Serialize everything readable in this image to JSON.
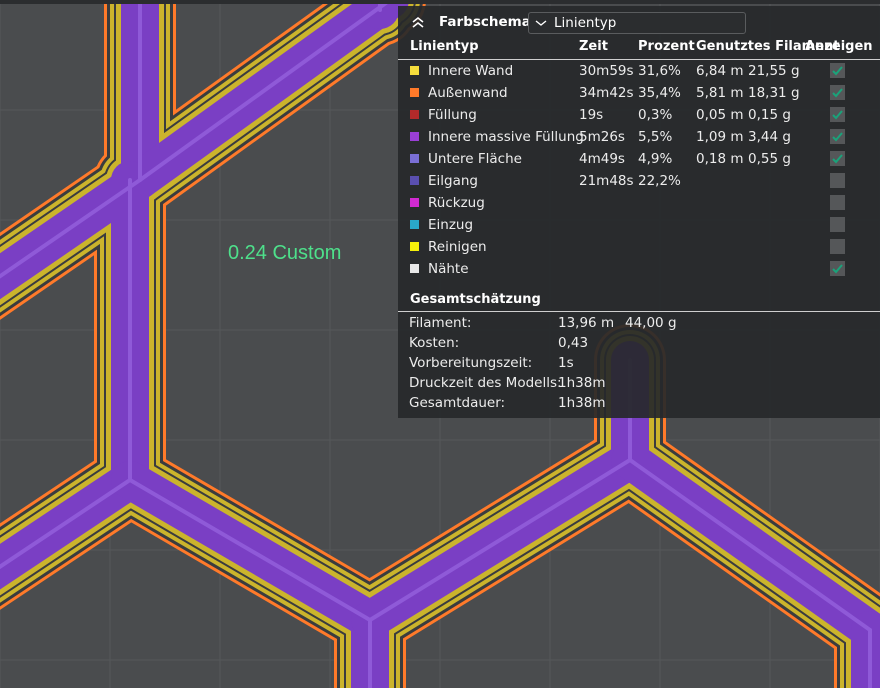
{
  "plate_label": "0.24 Custom",
  "panel": {
    "title": "Farbschema",
    "scheme_select": "Linientyp",
    "columns": [
      "Linientyp",
      "Zeit",
      "Prozent",
      "Genutztes Filament",
      "Anzeigen"
    ],
    "rows": [
      {
        "name": "Innere Wand",
        "time": "30m59s",
        "percent": "31,6%",
        "length": "6,84 m",
        "weight": "21,55 g",
        "color": "#f5dd3c",
        "shown": true
      },
      {
        "name": "Außenwand",
        "time": "34m42s",
        "percent": "35,4%",
        "length": "5,81 m",
        "weight": "18,31 g",
        "color": "#ff7a2a",
        "shown": true
      },
      {
        "name": "Füllung",
        "time": "19s",
        "percent": "0,3%",
        "length": "0,05 m",
        "weight": "0,15 g",
        "color": "#b22a2a",
        "shown": true
      },
      {
        "name": "Innere massive Füllung",
        "time": "5m26s",
        "percent": "5,5%",
        "length": "1,09 m",
        "weight": "3,44 g",
        "color": "#9a3fd6",
        "shown": true
      },
      {
        "name": "Untere Fläche",
        "time": "4m49s",
        "percent": "4,9%",
        "length": "0,18 m",
        "weight": "0,55 g",
        "color": "#7a6fd6",
        "shown": true
      },
      {
        "name": "Eilgang",
        "time": "21m48s",
        "percent": "22,2%",
        "length": "",
        "weight": "",
        "color": "#5a4fb0",
        "shown": false
      },
      {
        "name": "Rückzug",
        "time": "",
        "percent": "",
        "length": "",
        "weight": "",
        "color": "#d22ad2",
        "shown": false
      },
      {
        "name": "Einzug",
        "time": "",
        "percent": "",
        "length": "",
        "weight": "",
        "color": "#2aa8c8",
        "shown": false
      },
      {
        "name": "Reinigen",
        "time": "",
        "percent": "",
        "length": "",
        "weight": "",
        "color": "#f5f00a",
        "shown": false
      },
      {
        "name": "Nähte",
        "time": "",
        "percent": "",
        "length": "",
        "weight": "",
        "color": "#e8e8e8",
        "shown": true
      }
    ],
    "summary": {
      "title": "Gesamtschätzung",
      "items": [
        {
          "label": "Filament:",
          "value": "13,96 m",
          "extra": "44,00 g"
        },
        {
          "label": "Kosten:",
          "value": "0,43",
          "extra": ""
        },
        {
          "label": "Vorbereitungszeit:",
          "value": "1s",
          "extra": ""
        },
        {
          "label": "Druckzeit des Modells:",
          "value": "1h38m",
          "extra": ""
        },
        {
          "label": "Gesamtdauer:",
          "value": "1h38m",
          "extra": ""
        }
      ]
    }
  },
  "colors": {
    "background": "#4a4c4e",
    "panel": "#26282a",
    "check_accent": "#1aa37a",
    "label_green": "#4ee08b"
  }
}
